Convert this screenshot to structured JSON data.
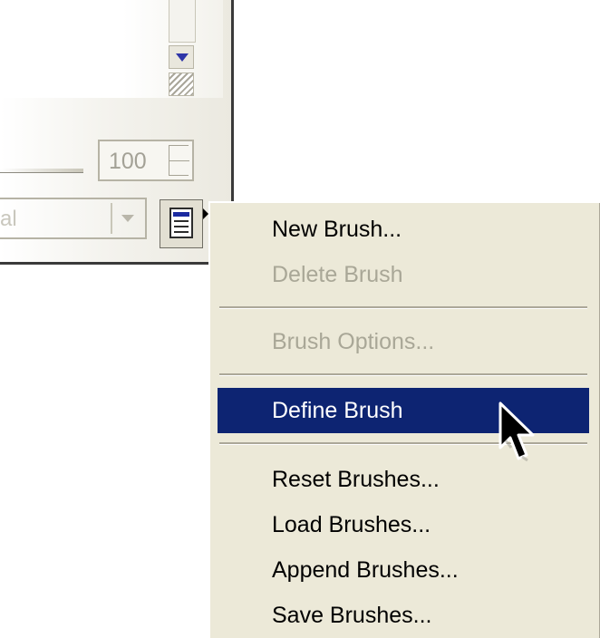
{
  "panel": {
    "opacity_value": "100",
    "mode_value": "al"
  },
  "menu": {
    "items": [
      {
        "label": "New Brush...",
        "state": "enabled"
      },
      {
        "label": "Delete Brush",
        "state": "disabled"
      },
      {
        "label": "Brush Options...",
        "state": "disabled"
      },
      {
        "label": "Define Brush",
        "state": "highlighted"
      },
      {
        "label": "Reset Brushes...",
        "state": "enabled"
      },
      {
        "label": "Load Brushes...",
        "state": "enabled"
      },
      {
        "label": "Append Brushes...",
        "state": "enabled"
      },
      {
        "label": "Save Brushes...",
        "state": "enabled"
      }
    ]
  },
  "icons": {
    "scroll_down": "scroll-down-arrow-icon",
    "resize_grip": "resize-grip-icon",
    "palette_menu": "palette-menu-icon",
    "flyout": "flyout-arrow-icon",
    "cursor": "mouse-pointer-icon"
  },
  "colors": {
    "menu_bg": "#ece9d8",
    "highlight": "#0d2472",
    "disabled_text": "#a9a797"
  }
}
